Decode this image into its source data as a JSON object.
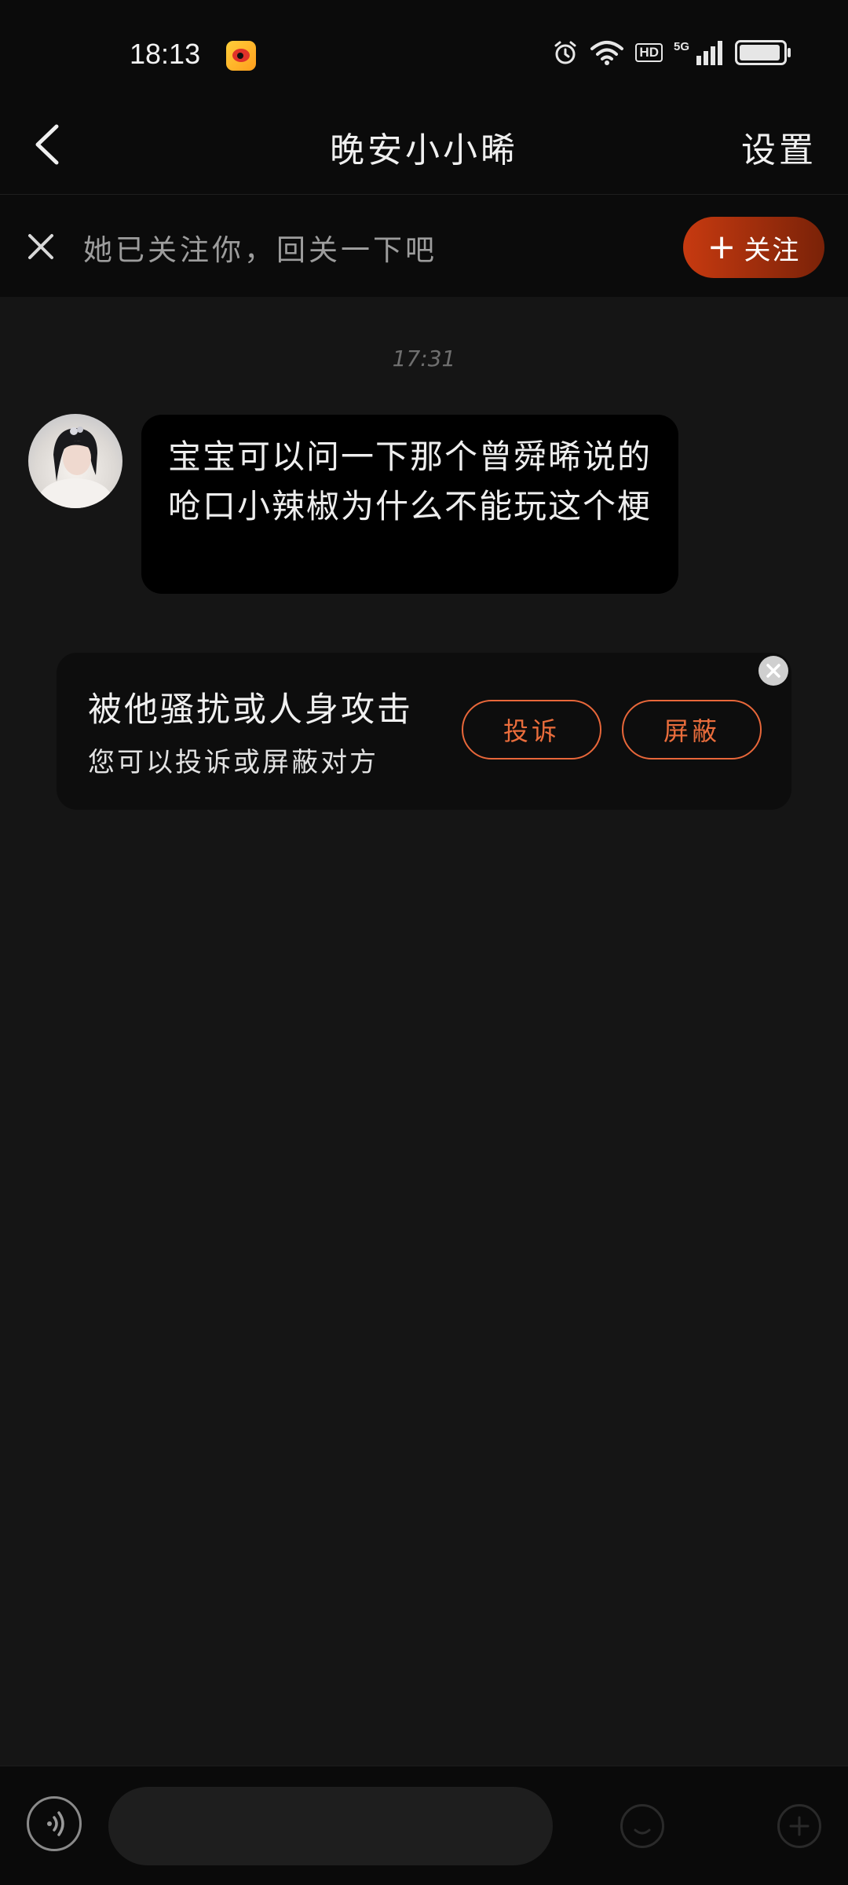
{
  "status_bar": {
    "time": "18:13",
    "app_icon": "weibo-icon",
    "network_label": "5G",
    "hd_label": "HD",
    "battery_level": 0.95
  },
  "header": {
    "title": "晚安小小晞",
    "settings_label": "设置",
    "back_icon": "chevron-left-icon"
  },
  "follow_banner": {
    "text": "她已关注你，回关一下吧",
    "follow_button_label": "关注",
    "follow_plus": "+",
    "accent_color": "#c73a10"
  },
  "chat": {
    "timestamp": "17:31",
    "messages": [
      {
        "sender": "other",
        "text": "宝宝可以问一下那个曾舜晞说的呛口小辣椒为什么不能玩这个梗"
      }
    ]
  },
  "harassment_card": {
    "title": "被他骚扰或人身攻击",
    "subtitle": "您可以投诉或屏蔽对方",
    "report_label": "投诉",
    "block_label": "屏蔽",
    "accent_color": "#e8673a"
  },
  "input_bar": {
    "placeholder": "",
    "voice_icon": "voice-icon"
  }
}
